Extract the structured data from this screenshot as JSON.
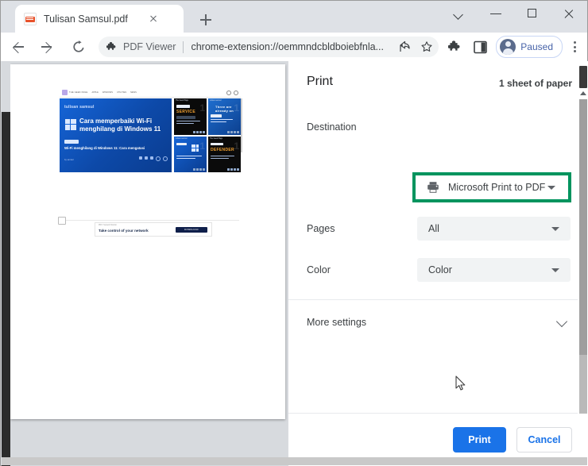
{
  "window": {
    "controls": {
      "tab_search": "chevron-down",
      "minimize": "minimize",
      "maximize": "maximize",
      "close": "close"
    }
  },
  "tabstrip": {
    "tab": {
      "title": "Tulisan Samsul.pdf",
      "favicon": "pdf-icon",
      "close_label": "Close tab"
    },
    "new_tab_label": "New Tab"
  },
  "toolbar": {
    "back": "back-arrow",
    "forward": "forward-arrow",
    "reload": "reload-icon",
    "omnibox": {
      "extension_name": "PDF Viewer",
      "url": "chrome-extension://oemmndcbldboiebfnla...",
      "share_icon": "share-icon",
      "bookmark_icon": "star-icon"
    },
    "extensions_icon": "puzzle-icon",
    "sidepanel_icon": "side-panel-icon",
    "profile": {
      "label": "Paused",
      "avatar": "avatar-icon"
    },
    "menu_icon": "kebab-menu-icon"
  },
  "preview": {
    "page": {
      "nav": {
        "brand": "THE GEEK PAGE",
        "links": [
          "APPLE",
          "WINDOWS",
          "UTILITIES",
          "NEWS"
        ],
        "tools": [
          "search-icon",
          "account-icon"
        ]
      },
      "hero": {
        "site": "tulisan samsul",
        "title": "Cara memperbaiki Wi-Fi menghilang di Windows 11",
        "badge": "Windows",
        "subtitle": "Wi-Fi menghilang di Windows 11: Cara mengatasi",
        "meta": "by samsul"
      },
      "cards": [
        {
          "site": "The Geek Page",
          "word": "SERVICE",
          "tag": "Disabled",
          "number": "1"
        },
        {
          "site": "tulisan samsul",
          "word": "Three are already on",
          "tag": "Windows",
          "number": "1"
        },
        {
          "site": "tulisan samsul",
          "word": "",
          "tag": "Reset",
          "number": "1"
        },
        {
          "site": "The Geek Page",
          "word": "DEFENDER",
          "tag": "Turn off",
          "number": "1"
        }
      ],
      "banner": {
        "sup": "PRO: Network Monitor",
        "text": "Take control of your network",
        "button": "DOWNLOAD"
      }
    }
  },
  "print_dialog": {
    "title": "Print",
    "sheets": "1 sheet of paper",
    "rows": [
      {
        "label": "Destination",
        "value": "Microsoft Print to PDF",
        "icon": "printer-icon",
        "highlighted": true
      },
      {
        "label": "Pages",
        "value": "All",
        "icon": null,
        "highlighted": false
      },
      {
        "label": "Color",
        "value": "Color",
        "icon": null,
        "highlighted": false
      }
    ],
    "more_settings": {
      "label": "More settings",
      "icon": "chevron-down-icon"
    },
    "buttons": {
      "print": "Print",
      "cancel": "Cancel"
    },
    "highlight_color": "#00945e",
    "accent_color": "#1a73e8"
  }
}
